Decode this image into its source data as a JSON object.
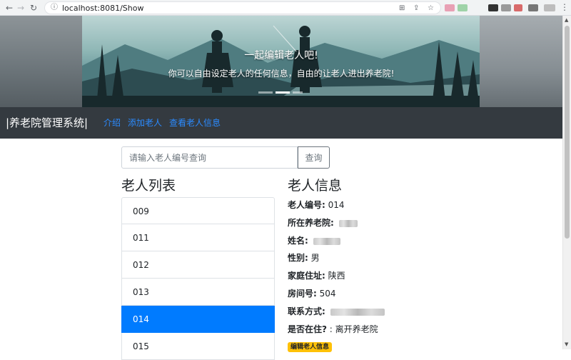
{
  "browser": {
    "url": "localhost:8081/Show",
    "back_glyph": "←",
    "forward_glyph": "→",
    "reload_glyph": "↻",
    "info_glyph": "ⓘ",
    "translate_glyph": "⊞",
    "share_glyph": "⇪",
    "bookmark_glyph": "☆",
    "menu_glyph": "⋮"
  },
  "hero": {
    "title": "一起编辑老人吧!",
    "subtitle": "你可以自由设定老人的任何信息，自由的让老人进出养老院!"
  },
  "navbar": {
    "brand": "|养老院管理系统|",
    "links": [
      "介绍",
      "添加老人",
      "查看老人信息"
    ]
  },
  "search": {
    "placeholder": "请输入老人编号查询",
    "button": "查询"
  },
  "list": {
    "heading": "老人列表",
    "items": [
      "009",
      "011",
      "012",
      "013",
      "014",
      "015"
    ],
    "active_item": "014"
  },
  "info": {
    "heading": "老人信息",
    "id_label": "老人编号:",
    "id_value": "014",
    "home_label": "所在养老院:",
    "name_label": "姓名:",
    "gender_label": "性别:",
    "gender_value": "男",
    "address_label": "家庭住址:",
    "address_value": "陕西",
    "room_label": "房间号:",
    "room_value": "504",
    "contact_label": "联系方式:",
    "present_label": "是否在住?",
    "present_value": ": 离开养老院",
    "edit_button": "编辑老人信息"
  },
  "colors": {
    "navbar_bg": "#343a40",
    "link": "#2b8bff",
    "active": "#007bff",
    "badge": "#ffc107"
  },
  "icons": [
    "back-arrow-icon",
    "forward-arrow-icon",
    "reload-icon",
    "info-icon",
    "translate-icon",
    "share-icon",
    "bookmark-star-icon",
    "menu-dots-icon"
  ]
}
